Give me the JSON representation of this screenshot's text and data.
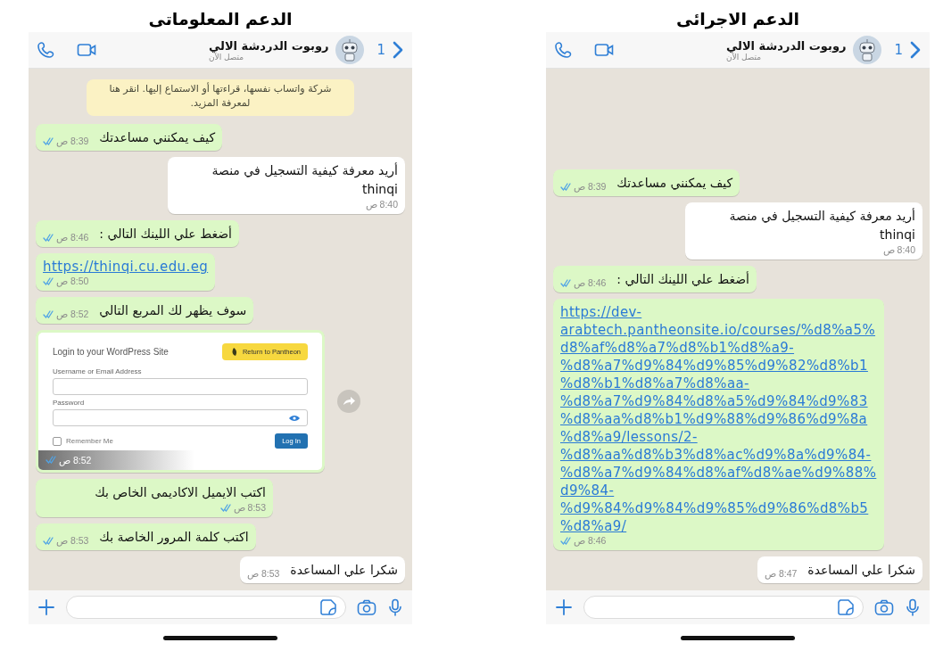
{
  "panels": [
    {
      "caption": "الدعم الاجرائى",
      "header": {
        "back_count": "1",
        "contact_name": "روبوت الدردشة الالي",
        "status": "متصل الآن"
      },
      "messages": [
        {
          "kind": "text",
          "outgoing": false,
          "text": "كيف يمكنني مساعدتك",
          "time": "8:39 ص",
          "read": true
        },
        {
          "kind": "text",
          "outgoing": true,
          "text": "أريد معرفة كيفية التسجيل في منصة thinqi",
          "time": "8:40 ص",
          "read": false
        },
        {
          "kind": "text",
          "outgoing": false,
          "text": "أضغط علي اللينك التالي :",
          "time": "8:46 ص",
          "read": true
        },
        {
          "kind": "link",
          "outgoing": false,
          "text": "https://dev-arabtech.pantheonsite.io/courses/%d8%a5%d8%af%d8%a7%d8%b1%d8%a9-%d8%a7%d9%84%d9%85%d9%82%d8%b1%d8%b1%d8%a7%d8%aa-%d8%a7%d9%84%d8%a5%d9%84%d9%83%d8%aa%d8%b1%d9%88%d9%86%d9%8a%d8%a9/lessons/2-%d8%aa%d8%b3%d8%ac%d9%8a%d9%84-%d8%a7%d9%84%d8%af%d8%ae%d9%88%d9%84-%d9%84%d9%84%d9%85%d9%86%d8%b5%d8%a9/",
          "time": "8:46 ص",
          "read": true
        },
        {
          "kind": "text",
          "outgoing": true,
          "text": "شكرا علي المساعدة",
          "time": "8:47 ص",
          "read": false
        }
      ]
    },
    {
      "caption": "الدعم المعلوماتى",
      "header": {
        "back_count": "1",
        "contact_name": "روبوت الدردشة الالي",
        "status": "متصل الآن"
      },
      "notice": "شركة واتساب نفسها، قراءتها أو الاستماع إليها. انقر هنا لمعرفة المزيد.",
      "messages": [
        {
          "kind": "text",
          "outgoing": false,
          "text": "كيف يمكنني مساعدتك",
          "time": "8:39 ص",
          "read": true
        },
        {
          "kind": "text",
          "outgoing": true,
          "text": "أريد معرفة كيفية التسجيل في منصة thinqi",
          "time": "8:40 ص",
          "read": false
        },
        {
          "kind": "text",
          "outgoing": false,
          "text": "أضغط علي اللينك التالي :",
          "time": "8:46 ص",
          "read": true
        },
        {
          "kind": "link",
          "outgoing": false,
          "text": "https://thinqi.cu.edu.eg",
          "time": "8:50 ص",
          "read": true
        },
        {
          "kind": "text",
          "outgoing": false,
          "text": "سوف يظهر لك المربع التالي",
          "time": "8:52 ص",
          "read": true
        },
        {
          "kind": "image",
          "outgoing": false,
          "time": "8:52 ص",
          "read": true,
          "login": {
            "title": "Login to your WordPress Site",
            "return_button": "Return to Pantheon",
            "username_label": "Username or Email Address",
            "password_label": "Password",
            "remember_label": "Remember Me",
            "remember_checked": false,
            "login_button": "Log In"
          }
        },
        {
          "kind": "text",
          "outgoing": false,
          "text": "اكتب الايميل الاكاديمى الخاص بك",
          "time": "8:53 ص",
          "read": true
        },
        {
          "kind": "text",
          "outgoing": false,
          "text": "اكتب كلمة المرور الخاصة بك",
          "time": "8:53 ص",
          "read": true
        },
        {
          "kind": "text",
          "outgoing": true,
          "text": "شكرا علي المساعدة",
          "time": "8:53 ص",
          "read": false
        }
      ]
    }
  ]
}
